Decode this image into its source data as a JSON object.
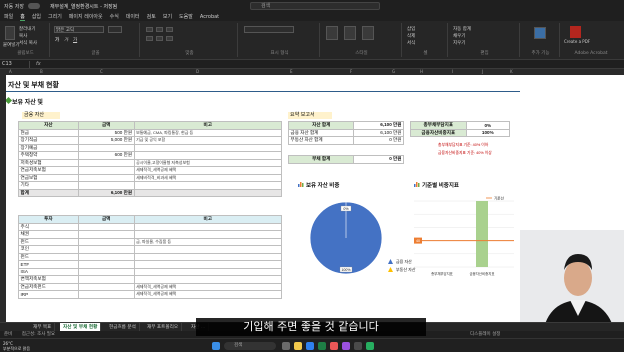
{
  "window": {
    "autosave_label": "자동 저장",
    "doc_title": "재무설계_열정환경시트 - 저장됨",
    "search_placeholder": "검색"
  },
  "menu": [
    "파일",
    "홈",
    "삽입",
    "그리기",
    "페이지 레이아웃",
    "수식",
    "데이터",
    "검토",
    "보기",
    "도움말",
    "Acrobat"
  ],
  "ribbon": {
    "clipboard": {
      "paste": "붙여넣기",
      "cut": "잘라내기",
      "copy": "복사",
      "format": "서식 복사",
      "label": "클립보드"
    },
    "font": {
      "name": "맑은 고딕",
      "label": "글꼴"
    },
    "align": {
      "label": "맞춤"
    },
    "number": {
      "label": "표시 형식"
    },
    "styles": {
      "label": "스타일"
    },
    "cells": {
      "insert": "삽입",
      "delete": "삭제",
      "format": "서식",
      "label": "셀"
    },
    "editing": {
      "autosum": "자동 합계",
      "fill": "채우기",
      "clear": "지우기",
      "label": "편집"
    },
    "addins": {
      "label": "추가 기능"
    },
    "acrobat": {
      "create": "Create a PDF",
      "label": "Adobe Acrobat"
    }
  },
  "namebox": "C13",
  "columns": [
    "A",
    "B",
    "C",
    "D",
    "E",
    "F",
    "G",
    "H",
    "I",
    "J",
    "K"
  ],
  "sheet": {
    "title": "자산 및 부채 현황",
    "section": "보유 자산 및",
    "finance_label": "금융 자산",
    "finance_headers": [
      "자산",
      "금액",
      "비고"
    ],
    "finance_rows": [
      {
        "name": "현금",
        "amount": "500 만원",
        "note": "보통예금, CMA, 파킹통장, 현금 등"
      },
      {
        "name": "장기적금",
        "amount": "5,000 만원",
        "note": "기금 및 공익 포함"
      },
      {
        "name": "장기예금",
        "amount": "",
        "note": ""
      },
      {
        "name": "주택청약",
        "amount": "600 만원",
        "note": ""
      },
      {
        "name": "저축성보험",
        "amount": "",
        "note": "공시이율,고정이율형 저축성보험"
      },
      {
        "name": "연금저축보험",
        "amount": "",
        "note": "세제적격_세액공제 혜택"
      },
      {
        "name": "연금보험",
        "amount": "",
        "note": "세제비적격_비과세 혜택"
      },
      {
        "name": "기타",
        "amount": "",
        "note": ""
      }
    ],
    "finance_total": {
      "name": "합계",
      "amount": "6,100 만원"
    },
    "invest_headers": [
      "투자",
      "금액",
      "비고"
    ],
    "invest_rows": [
      {
        "name": "주식",
        "note": ""
      },
      {
        "name": "채권",
        "note": ""
      },
      {
        "name": "펀드",
        "note": "금, 파실물, 수집품 등"
      },
      {
        "name": "코인",
        "note": ""
      },
      {
        "name": "펀드",
        "note": ""
      },
      {
        "name": "ETF",
        "note": ""
      },
      {
        "name": "ISA",
        "note": ""
      },
      {
        "name": "변액저축보험",
        "note": ""
      },
      {
        "name": "연금저축펀드",
        "note": "세제적격_세액공제 혜택"
      },
      {
        "name": "IRP",
        "note": "세제적격_세액공제 혜택"
      }
    ],
    "summary_label": "요약 보고서",
    "summary_rows": [
      {
        "name": "자산 합계",
        "value": "6,100 만원"
      },
      {
        "name": "금융 자산 합계",
        "value": "6,100 만원"
      },
      {
        "name": "부동산 자산 합계",
        "value": "0 만원"
      }
    ],
    "debt_row": {
      "name": "부채 합계",
      "value": "0 만원"
    },
    "indicators": [
      {
        "name": "총부채부담지표",
        "value": "0%"
      },
      {
        "name": "금융자산비중지표",
        "value": "100%"
      }
    ],
    "indicator_notes": [
      "총부채부담지표 기준: 40% 이하",
      "금융자산비중지표 기준: 40% 이상"
    ]
  },
  "pie_chart": {
    "title": "보유 자산 비중",
    "top_label": "0%",
    "bottom_label": "100%",
    "legend": [
      {
        "name": "금융 자산",
        "color": "#4472c4"
      },
      {
        "name": "부동산 자산",
        "color": "#ffc000"
      }
    ]
  },
  "chart_data": [
    {
      "type": "pie",
      "title": "보유 자산 비중",
      "categories": [
        "금융 자산",
        "부동산 자산"
      ],
      "values": [
        100,
        0
      ]
    },
    {
      "type": "bar",
      "title": "기준별 비중지표",
      "categories": [
        "총부채부담지표",
        "금융자산비중지표"
      ],
      "values": [
        0,
        100
      ],
      "ylim": [
        0,
        100
      ],
      "reference_label": "기준선",
      "reference_value_label": "40"
    }
  ],
  "bar_chart": {
    "title": "기준별 비중지표",
    "ref_label": "기준선",
    "ref_value": "40"
  },
  "tabs": [
    "재무 목표",
    "자산 및 부채 현황",
    "현금흐름 분석",
    "재무 포트폴리오",
    "자산 ..."
  ],
  "status": {
    "ready": "준비",
    "accessibility": "접근성: 조사 필요",
    "zoom": "디스플레이 설정"
  },
  "taskbar": {
    "temp": "26°C",
    "weather": "부분적으로 맑음",
    "search": "검색"
  },
  "caption": "기입해 주면 좋을 것 같습니다"
}
